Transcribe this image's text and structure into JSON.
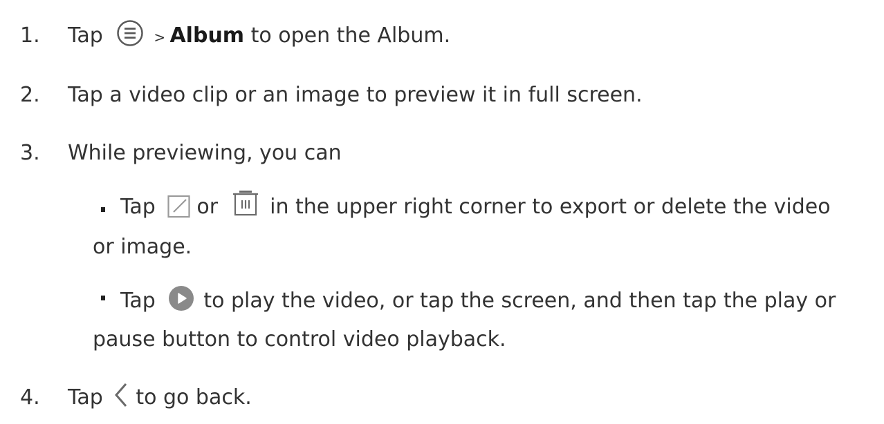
{
  "steps": [
    {
      "number": "1.",
      "pre": "Tap",
      "sep": "> ",
      "bold": "Album",
      "post": "to open the Album."
    },
    {
      "number": "2.",
      "text": "Tap a video clip or an image to preview it in full screen."
    },
    {
      "number": "3.",
      "text": "While previewing, you can",
      "bullets": [
        {
          "pre": "Tap",
          "mid": "or",
          "post": "in the upper right corner to export or delete the video",
          "cont": "or image."
        },
        {
          "pre": "Tap",
          "post": "to play the video, or tap the screen, and then tap the play or",
          "cont": "pause button to control video playback."
        }
      ]
    },
    {
      "number": "4.",
      "pre": "Tap",
      "post": "to go back."
    }
  ],
  "icons": {
    "menu": "menu-circle-icon",
    "export": "export-icon",
    "delete": "trash-icon",
    "play": "play-icon",
    "back": "chevron-left-icon"
  },
  "colors": {
    "text": "#333333",
    "icon_gray": "#8a8a8a",
    "play_fill": "#8a8a8a"
  }
}
